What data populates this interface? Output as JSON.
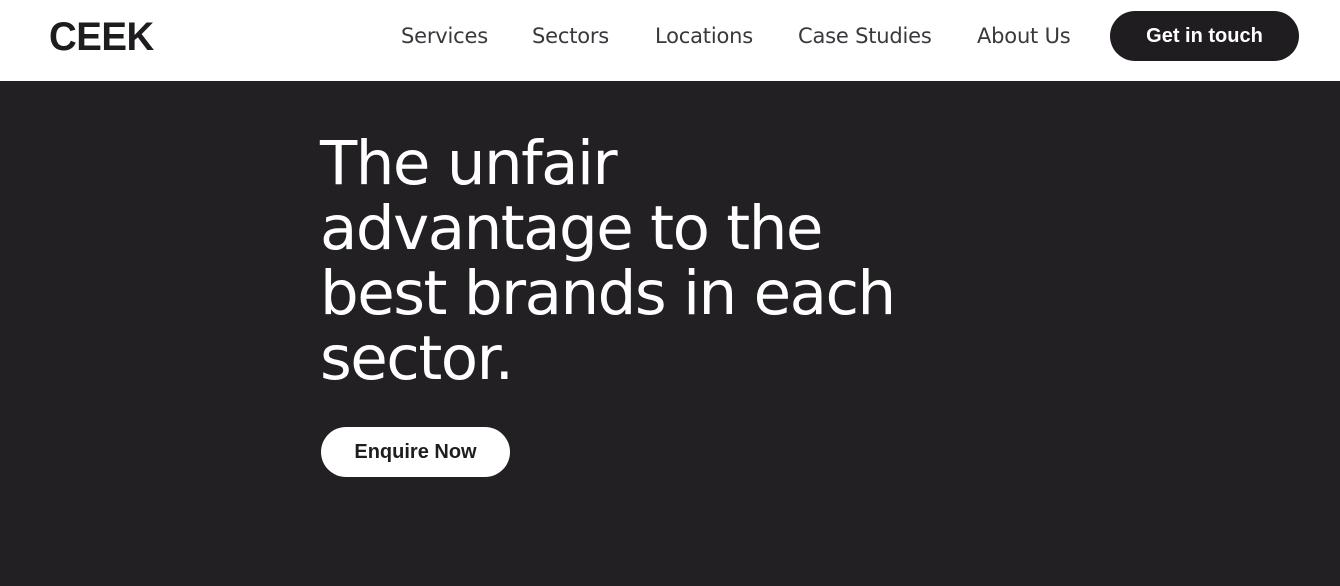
{
  "header": {
    "logo": "CEEK",
    "nav": [
      {
        "label": "Services"
      },
      {
        "label": "Sectors"
      },
      {
        "label": "Locations"
      },
      {
        "label": "Case Studies"
      },
      {
        "label": "About Us"
      }
    ],
    "cta_label": "Get in touch"
  },
  "hero": {
    "headline_lines": [
      "The unfair",
      "advantage to the",
      "best brands in each",
      "sector."
    ],
    "button_label": "Enquire Now"
  },
  "colors": {
    "hero_background": "#222023",
    "header_background": "#ffffff",
    "primary_dark": "#1f1d20",
    "text_light": "#ffffff"
  }
}
